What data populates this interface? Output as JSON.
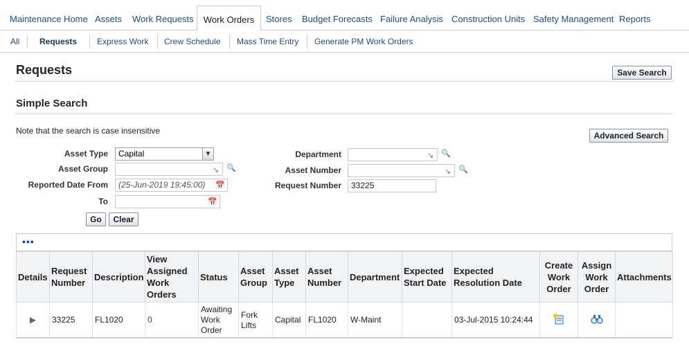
{
  "tabs": [
    {
      "label": "Maintenance Home",
      "active": false
    },
    {
      "label": "Assets",
      "active": false
    },
    {
      "label": "Work Requests",
      "active": false
    },
    {
      "label": "Work Orders",
      "active": true
    },
    {
      "label": "Stores",
      "active": false
    },
    {
      "label": "Budget Forecasts",
      "active": false
    },
    {
      "label": "Failure Analysis",
      "active": false
    },
    {
      "label": "Construction Units",
      "active": false
    },
    {
      "label": "Safety Management",
      "active": false
    },
    {
      "label": "Reports",
      "active": false
    }
  ],
  "subtabs": [
    {
      "label": "All",
      "active": false
    },
    {
      "label": "Requests",
      "active": true
    },
    {
      "label": "Express Work",
      "active": false
    },
    {
      "label": "Crew Schedule",
      "active": false
    },
    {
      "label": "Mass Time Entry",
      "active": false
    },
    {
      "label": "Generate PM Work Orders",
      "active": false
    }
  ],
  "page": {
    "title": "Requests",
    "save_search": "Save Search",
    "section_title": "Simple Search",
    "note": "Note that the search is case insensitive",
    "advanced_search": "Advanced Search"
  },
  "form": {
    "asset_type_label": "Asset Type",
    "asset_type_value": "Capital",
    "asset_group_label": "Asset Group",
    "asset_group_value": "",
    "reported_from_label": "Reported Date From",
    "reported_from_placeholder": "(25-Jun-2019 19:45:00)",
    "to_label": "To",
    "to_value": "",
    "department_label": "Department",
    "department_value": "",
    "asset_number_label": "Asset Number",
    "asset_number_value": "",
    "request_number_label": "Request Number",
    "request_number_value": "33225",
    "go": "Go",
    "clear": "Clear"
  },
  "table": {
    "headers": {
      "details": "Details",
      "request_number": "Request Number",
      "description": "Description",
      "view_assigned": "View Assigned Work Orders",
      "status": "Status",
      "asset_group": "Asset Group",
      "asset_type": "Asset Type",
      "asset_number": "Asset Number",
      "department": "Department",
      "expected_start": "Expected Start Date",
      "expected_resolution": "Expected Resolution Date",
      "create_wo": "Create Work Order",
      "assign_wo": "Assign Work Order",
      "attachments": "Attachments"
    },
    "rows": [
      {
        "request_number": "33225",
        "description": "FL1020",
        "view_assigned": "0",
        "status": "Awaiting Work Order",
        "asset_group": "Fork Lifts",
        "asset_type": "Capital",
        "asset_number": "FL1020",
        "department": "W-Maint",
        "expected_start": "",
        "expected_resolution": "03-Jul-2015 10:24:44",
        "attachments": ""
      }
    ]
  },
  "icons": {
    "flashlight": "flashlight-search-icon",
    "calendar": "calendar-icon",
    "more": "more-options-icon",
    "create": "create-work-order-icon",
    "assign": "assign-work-order-icon"
  },
  "colors": {
    "link": "#1c4d8c",
    "border": "#c9cbd3"
  }
}
